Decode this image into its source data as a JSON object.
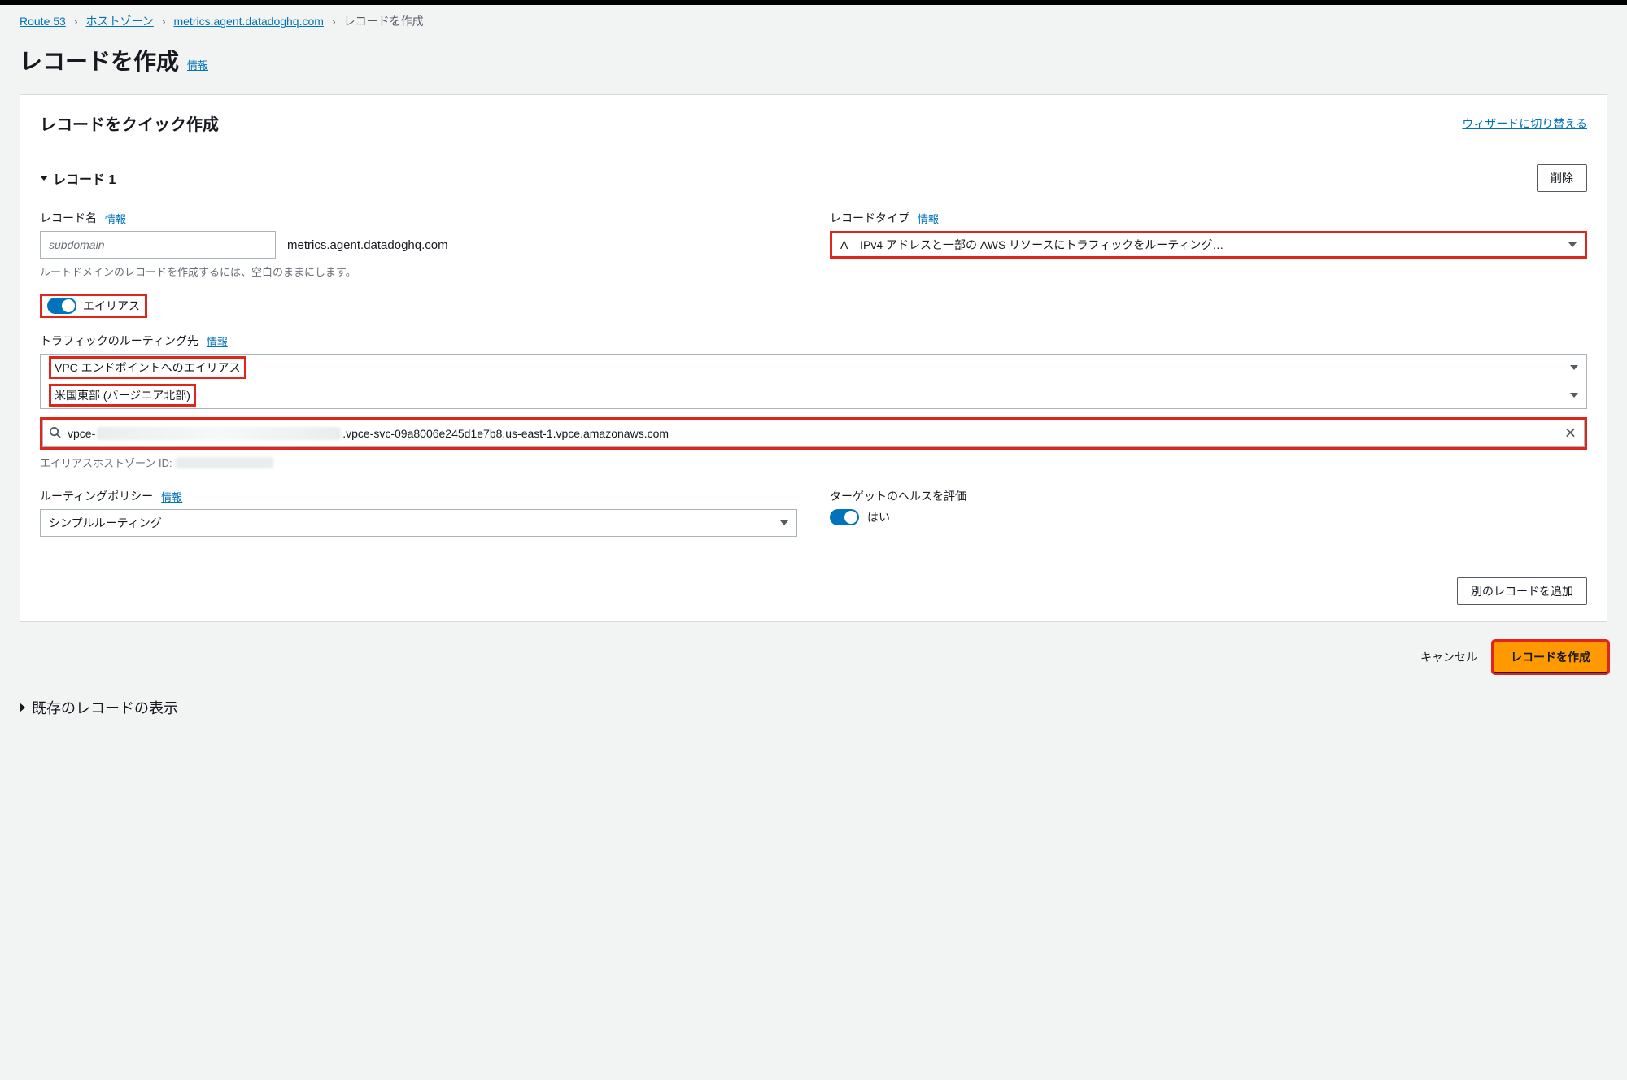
{
  "breadcrumb": {
    "root": "Route 53",
    "hosted_zones": "ホストゾーン",
    "domain": "metrics.agent.datadoghq.com",
    "current": "レコードを作成"
  },
  "page": {
    "title": "レコードを作成",
    "info": "情報"
  },
  "panel": {
    "title": "レコードをクイック作成",
    "switch_to_wizard": "ウィザードに切り替える"
  },
  "record": {
    "heading": "レコード 1",
    "delete": "削除",
    "name_label": "レコード名",
    "name_placeholder": "subdomain",
    "name_suffix": "metrics.agent.datadoghq.com",
    "name_help": "ルートドメインのレコードを作成するには、空白のままにします。",
    "type_label": "レコードタイプ",
    "type_value": "A – IPv4 アドレスと一部の AWS リソースにトラフィックをルーティング…",
    "alias_label": "エイリアス",
    "traffic_label": "トラフィックのルーティング先",
    "alias_target": "VPC エンドポイントへのエイリアス",
    "region": "米国東部 (バージニア北部)",
    "endpoint_prefix": "vpce-",
    "endpoint_suffix": ".vpce-svc-09a8006e245d1e7b8.us-east-1.vpce.amazonaws.com",
    "hosted_zone_label": "エイリアスホストゾーン ID:",
    "routing_label": "ルーティングポリシー",
    "routing_value": "シンプルルーティング",
    "health_label": "ターゲットのヘルスを評価",
    "health_value": "はい",
    "add_another": "別のレコードを追加"
  },
  "footer": {
    "cancel": "キャンセル",
    "submit": "レコードを作成"
  },
  "existing": {
    "label": "既存のレコードの表示"
  }
}
